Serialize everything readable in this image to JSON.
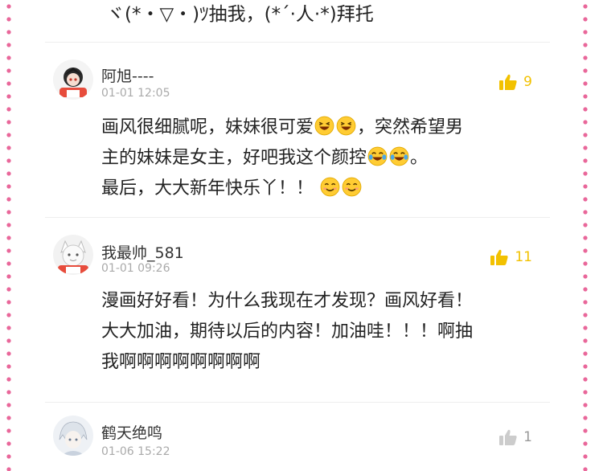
{
  "top_comment_tail": "ヾ(*・▽・)ﾂ抽我，(*´·人·*)拜托",
  "comments": [
    {
      "username": "阿旭----",
      "time": "01-01 12:05",
      "likes": "9",
      "body": [
        "画风很细腻呢，妹妹很可爱",
        "，突然希望男",
        "主的妹妹是女主，好吧我这个颜控",
        "。",
        "最后，大大新年快乐丫！！"
      ],
      "emoji_line1": [
        "laughing-emoji",
        "laughing-emoji"
      ],
      "emoji_line2": [
        "tears-of-joy-emoji",
        "tears-of-joy-emoji"
      ],
      "emoji_line3": [
        "smiling-emoji",
        "smiling-emoji"
      ]
    },
    {
      "username": "我最帅_581",
      "time": "01-01 09:26",
      "likes": "11",
      "body": [
        "漫画好好看！为什么我现在才发现？画风好看！",
        "大大加油，期待以后的内容！加油哇！！！啊抽",
        "我啊啊啊啊啊啊啊啊"
      ]
    },
    {
      "username": "鹤天绝鸣",
      "time": "01-06 15:22",
      "likes": "1"
    }
  ],
  "colors": {
    "border_dots": "#e9679a",
    "like_active": "#f2c100",
    "like_inactive": "#cccccc"
  }
}
